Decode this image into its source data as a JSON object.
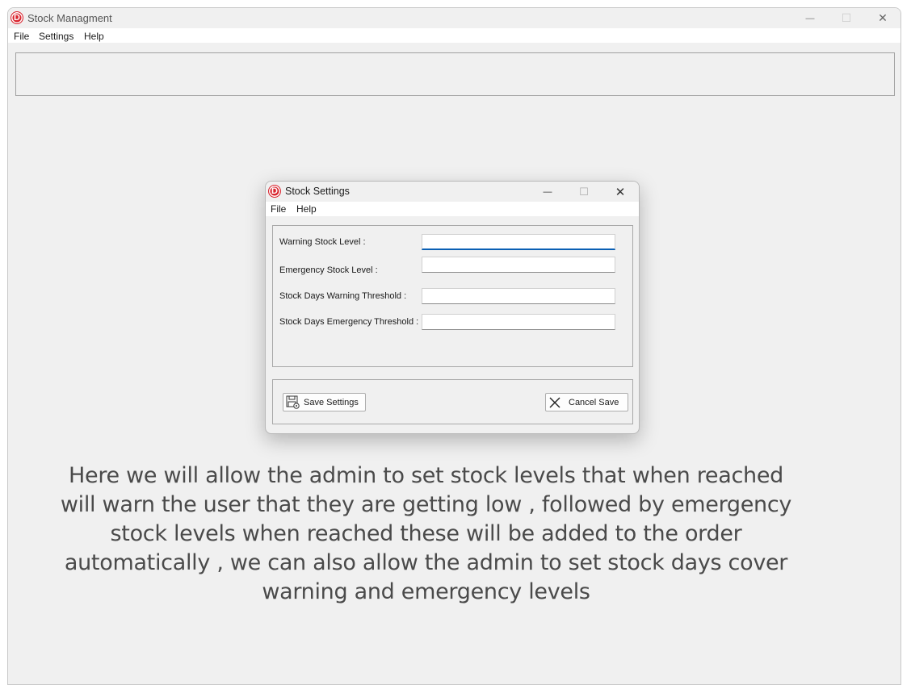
{
  "main_window": {
    "title": "Stock Managment",
    "logo_letter": "D",
    "controls": {
      "minimize": "—",
      "maximize": "☐",
      "close": "✕"
    },
    "menu": [
      "File",
      "Settings",
      "Help"
    ]
  },
  "dialog": {
    "title": "Stock Settings",
    "logo_letter": "D",
    "controls": {
      "minimize": "—",
      "maximize": "☐",
      "close": "✕"
    },
    "menu": [
      "File",
      "Help"
    ],
    "fields": [
      {
        "label": "Warning Stock Level :",
        "value": ""
      },
      {
        "label": "Emergency Stock Level :",
        "value": ""
      },
      {
        "label": "Stock Days Warning Threshold :",
        "value": ""
      },
      {
        "label": "Stock Days Emergency Threshold :",
        "value": ""
      }
    ],
    "buttons": {
      "save": {
        "label": "Save Settings",
        "icon": "save-settings-icon"
      },
      "cancel": {
        "label": "Cancel Save",
        "icon": "close-icon"
      }
    }
  },
  "caption": "Here we will allow the admin to set stock levels that when reached will warn the user that they are getting low , followed by emergency stock levels when reached these will be added to the order automatically , we can also allow the admin to set stock days cover warning and emergency levels",
  "colors": {
    "logo_red": "#d9252f",
    "focus_blue": "#0a5fb4",
    "window_bg": "#f0f0f0"
  }
}
